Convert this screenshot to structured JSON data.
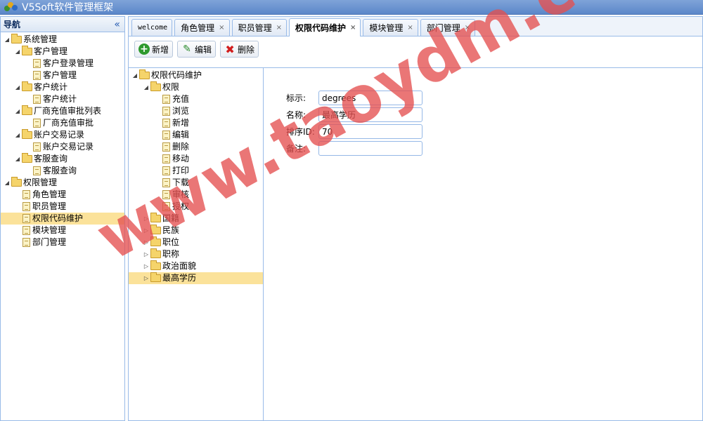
{
  "app": {
    "title": "V5Soft软件管理框架",
    "logo_icon": "app-logo-icon"
  },
  "nav": {
    "title": "导航",
    "collapse_glyph": "«",
    "tree": [
      {
        "label": "系统管理",
        "type": "folder",
        "expanded": true,
        "children": [
          {
            "label": "客户管理",
            "type": "folder",
            "expanded": true,
            "children": [
              {
                "label": "客户登录管理",
                "type": "file"
              },
              {
                "label": "客户管理",
                "type": "file"
              }
            ]
          },
          {
            "label": "客户统计",
            "type": "folder",
            "expanded": true,
            "children": [
              {
                "label": "客户统计",
                "type": "file"
              }
            ]
          },
          {
            "label": "厂商充值审批列表",
            "type": "folder",
            "expanded": true,
            "children": [
              {
                "label": "厂商充值审批",
                "type": "file"
              }
            ]
          },
          {
            "label": "账户交易记录",
            "type": "folder",
            "expanded": true,
            "children": [
              {
                "label": "账户交易记录",
                "type": "file"
              }
            ]
          },
          {
            "label": "客服查询",
            "type": "folder",
            "expanded": true,
            "children": [
              {
                "label": "客服查询",
                "type": "file"
              }
            ]
          }
        ]
      },
      {
        "label": "权限管理",
        "type": "folder",
        "expanded": true,
        "children": [
          {
            "label": "角色管理",
            "type": "file"
          },
          {
            "label": "职员管理",
            "type": "file"
          },
          {
            "label": "权限代码维护",
            "type": "file",
            "selected": true
          },
          {
            "label": "模块管理",
            "type": "file"
          },
          {
            "label": "部门管理",
            "type": "file"
          }
        ]
      }
    ]
  },
  "tabs": [
    {
      "label": "welcome",
      "closable": false,
      "active": false
    },
    {
      "label": "角色管理",
      "closable": true,
      "active": false
    },
    {
      "label": "职员管理",
      "closable": true,
      "active": false
    },
    {
      "label": "权限代码维护",
      "closable": true,
      "active": true
    },
    {
      "label": "模块管理",
      "closable": true,
      "active": false
    },
    {
      "label": "部门管理",
      "closable": true,
      "active": false
    }
  ],
  "toolbar": {
    "add_label": "新增",
    "edit_label": "编辑",
    "delete_label": "删除"
  },
  "code_tree": [
    {
      "label": "权限代码维护",
      "type": "folder",
      "expanded": true,
      "children": [
        {
          "label": "权限",
          "type": "folder",
          "expanded": true,
          "children": [
            {
              "label": "充值",
              "type": "file"
            },
            {
              "label": "浏览",
              "type": "file"
            },
            {
              "label": "新增",
              "type": "file"
            },
            {
              "label": "编辑",
              "type": "file"
            },
            {
              "label": "删除",
              "type": "file"
            },
            {
              "label": "移动",
              "type": "file"
            },
            {
              "label": "打印",
              "type": "file"
            },
            {
              "label": "下载",
              "type": "file"
            },
            {
              "label": "审核",
              "type": "file"
            },
            {
              "label": "授权",
              "type": "file"
            }
          ]
        },
        {
          "label": "国籍",
          "type": "folder",
          "expanded": false
        },
        {
          "label": "民族",
          "type": "folder",
          "expanded": false
        },
        {
          "label": "职位",
          "type": "folder",
          "expanded": false
        },
        {
          "label": "职称",
          "type": "folder",
          "expanded": false
        },
        {
          "label": "政治面貌",
          "type": "folder",
          "expanded": false
        },
        {
          "label": "最高学历",
          "type": "folder",
          "expanded": false,
          "selected": true
        }
      ]
    }
  ],
  "form": {
    "identifier_label": "标示:",
    "identifier_value": "degrees",
    "name_label": "名称:",
    "name_value": "最高学历",
    "sort_label": "排序ID:",
    "sort_value": "70",
    "remark_label": "备注:",
    "remark_value": ""
  },
  "watermark": "www.taoydm.com",
  "colors": {
    "selected": "#fbe29a",
    "border": "#99bbe8",
    "watermark": "#e45050"
  }
}
